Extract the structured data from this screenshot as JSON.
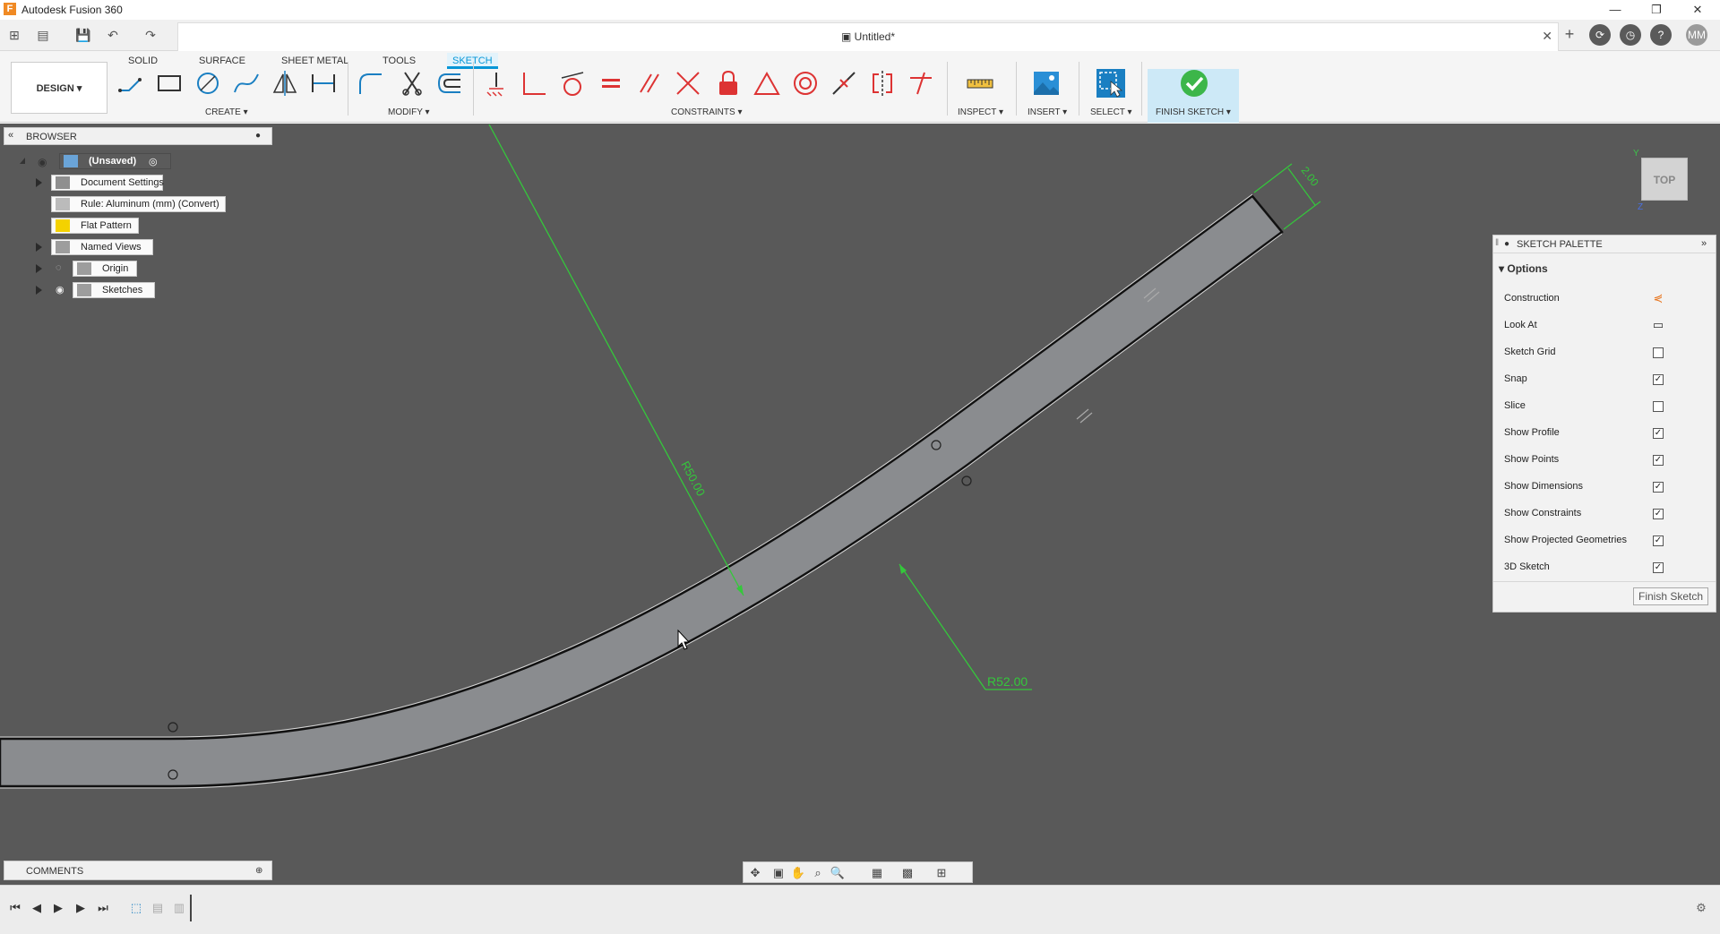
{
  "app": {
    "title": "Autodesk Fusion 360",
    "logo_letter": "F"
  },
  "window_controls": {
    "minimize": "—",
    "restore": "❐",
    "close": "✕"
  },
  "document": {
    "tab_title": "Untitled*"
  },
  "user": {
    "initials": "MM"
  },
  "ribbon": {
    "tabs": [
      "SOLID",
      "SURFACE",
      "SHEET METAL",
      "TOOLS",
      "SKETCH"
    ],
    "active_tab": "SKETCH",
    "workspace": "DESIGN ▾",
    "groups": {
      "create": "CREATE ▾",
      "modify": "MODIFY ▾",
      "constraints": "CONSTRAINTS ▾",
      "inspect": "INSPECT ▾",
      "insert": "INSERT ▾",
      "select": "SELECT ▾",
      "finish": "FINISH SKETCH ▾"
    }
  },
  "browser": {
    "header": "BROWSER",
    "items": [
      {
        "label": "(Unsaved)",
        "bold": true
      },
      {
        "label": "Document Settings"
      },
      {
        "label": "Rule: Aluminum (mm) (Convert)"
      },
      {
        "label": "Flat Pattern"
      },
      {
        "label": "Named Views"
      },
      {
        "label": "Origin"
      },
      {
        "label": "Sketches"
      }
    ]
  },
  "canvas": {
    "dimensions": {
      "r50": "R50.00",
      "r52": "R52.00",
      "thickness": "2.00"
    },
    "viewcube": "TOP"
  },
  "sketch_palette": {
    "header": "SKETCH PALETTE",
    "section": "Options",
    "rows": [
      {
        "label": "Construction",
        "kind": "icon",
        "icon": "construction-icon"
      },
      {
        "label": "Look At",
        "kind": "icon",
        "icon": "look-at-icon"
      },
      {
        "label": "Sketch Grid",
        "kind": "checkbox",
        "checked": false
      },
      {
        "label": "Snap",
        "kind": "checkbox",
        "checked": true
      },
      {
        "label": "Slice",
        "kind": "checkbox",
        "checked": false
      },
      {
        "label": "Show Profile",
        "kind": "checkbox",
        "checked": true
      },
      {
        "label": "Show Points",
        "kind": "checkbox",
        "checked": true
      },
      {
        "label": "Show Dimensions",
        "kind": "checkbox",
        "checked": true
      },
      {
        "label": "Show Constraints",
        "kind": "checkbox",
        "checked": true
      },
      {
        "label": "Show Projected Geometries",
        "kind": "checkbox",
        "checked": true
      },
      {
        "label": "3D Sketch",
        "kind": "checkbox",
        "checked": true
      }
    ],
    "finish_button": "Finish Sketch"
  },
  "comments": {
    "label": "COMMENTS"
  },
  "colors": {
    "accent": "#0696d7",
    "canvas_bg": "#595959",
    "dimension_green": "#2ecc40",
    "profile_fill": "#8a8c8f",
    "finish_check": "#3cb64a"
  }
}
